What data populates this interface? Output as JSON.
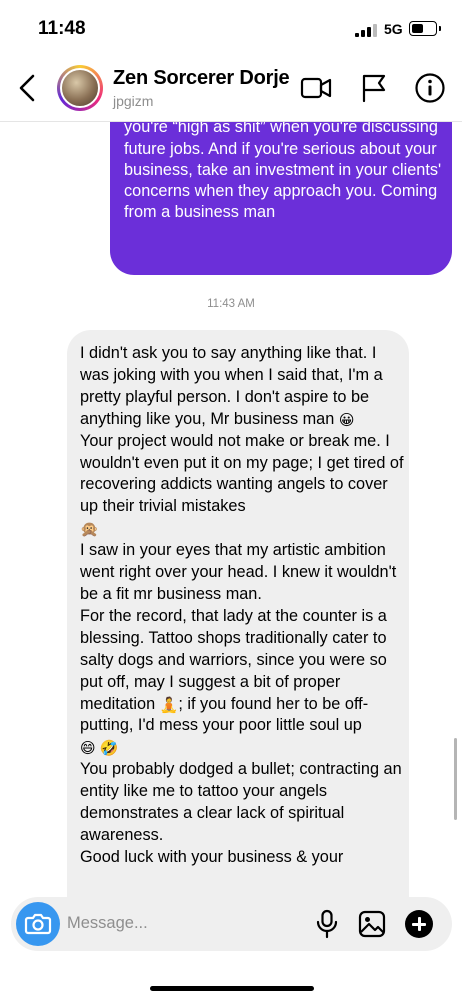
{
  "status_bar": {
    "time": "11:48",
    "network": "5G"
  },
  "header": {
    "name": "Zen Sorcerer Dorje",
    "handle": "jpgizm",
    "icons": [
      "back-arrow-icon",
      "video-camera-icon",
      "flag-icon",
      "info-icon"
    ]
  },
  "sent_message": {
    "text": "and be honest.. don't tell your clients that you're “high as shit” when you're discussing future jobs. And if you're serious about your business, take an investment in your clients' concerns when they approach you. Coming from a business man",
    "color": "#6b2fd9"
  },
  "timestamp": "11:43 AM",
  "received_message": {
    "p1": "I didn't ask you to say anything like that. I was joking with you when I said that, I'm a pretty playful person. I don't aspire to be anything like you, Mr business man",
    "p1_emoji": "😀",
    "p2": "Your project would not make or break me. I wouldn't even put it on my page; I get tired of recovering addicts wanting angels to cover up their trivial mistakes",
    "p2_emoji": "🙊",
    "p3": "I saw in your eyes that my artistic ambition went right over your head. I knew it wouldn't be a fit mr business man.",
    "p4_a": "For the record, that lady at the counter is a blessing. Tattoo shops traditionally cater to salty dogs and warriors, since you were so put off, may I suggest a bit of proper meditation",
    "p4_emoji_a": "🧘",
    "p4_b": "; if you found her to be off-putting, I'd mess your poor little soul up",
    "p4_emoji_b": "😄 🤣",
    "p5": "You probably dodged a bullet; contracting an entity like me to tattoo your angels demonstrates a clear lack of spiritual awareness.",
    "p6": "Good luck with your business & your"
  },
  "composer": {
    "placeholder": "Message...",
    "icons": [
      "camera-icon",
      "microphone-icon",
      "image-icon",
      "plus-icon"
    ],
    "accent": "#3797f0"
  }
}
